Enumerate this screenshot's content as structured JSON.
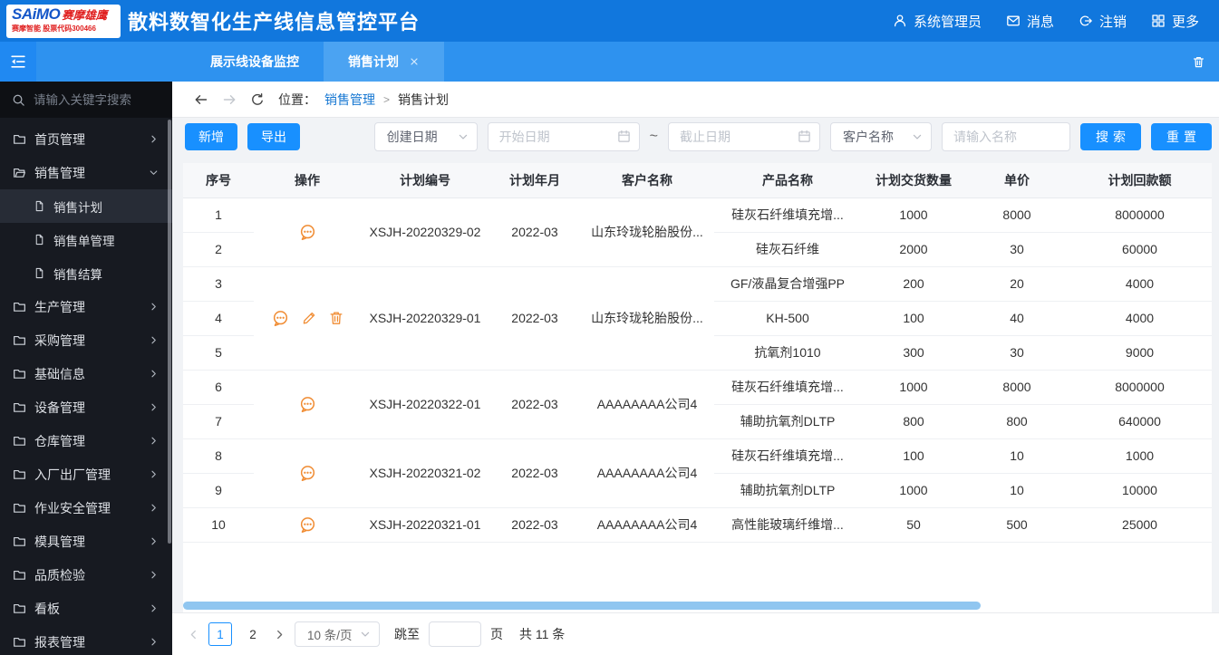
{
  "header": {
    "logo": {
      "brand": "SAiMO",
      "brand_suffix": "赛摩雄鹰",
      "subtitle": "赛摩智能 股票代码300466"
    },
    "title": "散料数智化生产线信息管控平台",
    "user_label": "系统管理员",
    "message_label": "消息",
    "logout_label": "注销",
    "more_label": "更多"
  },
  "tabbar": {
    "tabs": [
      {
        "label": "展示线设备监控",
        "active": false
      },
      {
        "label": "销售计划",
        "active": true
      }
    ]
  },
  "sidebar": {
    "search_placeholder": "请输入关键字搜索",
    "items": [
      {
        "label": "首页管理",
        "expanded": false
      },
      {
        "label": "销售管理",
        "expanded": true,
        "children": [
          {
            "label": "销售计划",
            "active": true
          },
          {
            "label": "销售单管理",
            "active": false
          },
          {
            "label": "销售结算",
            "active": false
          }
        ]
      },
      {
        "label": "生产管理",
        "expanded": false
      },
      {
        "label": "采购管理",
        "expanded": false
      },
      {
        "label": "基础信息",
        "expanded": false
      },
      {
        "label": "设备管理",
        "expanded": false
      },
      {
        "label": "仓库管理",
        "expanded": false
      },
      {
        "label": "入厂出厂管理",
        "expanded": false
      },
      {
        "label": "作业安全管理",
        "expanded": false
      },
      {
        "label": "模具管理",
        "expanded": false
      },
      {
        "label": "品质检验",
        "expanded": false
      },
      {
        "label": "看板",
        "expanded": false
      },
      {
        "label": "报表管理",
        "expanded": false
      }
    ]
  },
  "breadcrumb": {
    "prefix": "位置：",
    "parent": "销售管理",
    "separator": ">",
    "current": "销售计划"
  },
  "toolbar": {
    "add_label": "新增",
    "export_label": "导出",
    "date_type_select": "创建日期",
    "start_date_placeholder": "开始日期",
    "range_separator": "~",
    "end_date_placeholder": "截止日期",
    "customer_select": "客户名称",
    "name_input_placeholder": "请输入名称",
    "search_label": "搜索",
    "reset_label": "重置"
  },
  "table": {
    "columns": [
      "序号",
      "操作",
      "计划编号",
      "计划年月",
      "客户名称",
      "产品名称",
      "计划交货数量",
      "单价",
      "计划回款额"
    ],
    "groups": [
      {
        "plan_no": "XSJH-20220329-02",
        "plan_month": "2022-03",
        "customer": "山东玲珑轮胎股份...",
        "ops": [
          "comment"
        ],
        "rows": [
          {
            "no": "1",
            "product": "硅灰石纤维填充增...",
            "qty": "1000",
            "price": "8000",
            "amount": "8000000"
          },
          {
            "no": "2",
            "product": "硅灰石纤维",
            "qty": "2000",
            "price": "30",
            "amount": "60000"
          }
        ]
      },
      {
        "plan_no": "XSJH-20220329-01",
        "plan_month": "2022-03",
        "customer": "山东玲珑轮胎股份...",
        "ops": [
          "comment",
          "edit",
          "delete"
        ],
        "rows": [
          {
            "no": "3",
            "product": "GF/液晶复合增强PP",
            "qty": "200",
            "price": "20",
            "amount": "4000"
          },
          {
            "no": "4",
            "product": "KH-500",
            "qty": "100",
            "price": "40",
            "amount": "4000"
          },
          {
            "no": "5",
            "product": "抗氧剂1010",
            "qty": "300",
            "price": "30",
            "amount": "9000"
          }
        ]
      },
      {
        "plan_no": "XSJH-20220322-01",
        "plan_month": "2022-03",
        "customer": "AAAAAAAA公司4",
        "ops": [
          "comment"
        ],
        "rows": [
          {
            "no": "6",
            "product": "硅灰石纤维填充增...",
            "qty": "1000",
            "price": "8000",
            "amount": "8000000"
          },
          {
            "no": "7",
            "product": "辅助抗氧剂DLTP",
            "qty": "800",
            "price": "800",
            "amount": "640000"
          }
        ]
      },
      {
        "plan_no": "XSJH-20220321-02",
        "plan_month": "2022-03",
        "customer": "AAAAAAAA公司4",
        "ops": [
          "comment"
        ],
        "rows": [
          {
            "no": "8",
            "product": "硅灰石纤维填充增...",
            "qty": "100",
            "price": "10",
            "amount": "1000"
          },
          {
            "no": "9",
            "product": "辅助抗氧剂DLTP",
            "qty": "1000",
            "price": "10",
            "amount": "10000"
          }
        ]
      },
      {
        "plan_no": "XSJH-20220321-01",
        "plan_month": "2022-03",
        "customer": "AAAAAAAA公司4",
        "ops": [
          "comment"
        ],
        "rows": [
          {
            "no": "10",
            "product": "高性能玻璃纤维增...",
            "qty": "50",
            "price": "500",
            "amount": "25000"
          }
        ]
      }
    ]
  },
  "pagination": {
    "pages": [
      "1",
      "2"
    ],
    "active_page": "1",
    "page_size": "10 条/页",
    "jump_label": "跳至",
    "page_label": "页",
    "total_label": "共 11 条"
  },
  "colors": {
    "accent": "#1890ff",
    "header_blue": "#1177dd",
    "tabbar_blue": "#2e92ef",
    "tab_active_blue": "#4ba3f2",
    "sidebar_bg": "#171a21",
    "op_icon_orange": "#f08c33",
    "scrollbar_blue": "#90c6f0"
  },
  "icons": {
    "user-icon": "person-outline",
    "message-icon": "envelope",
    "logout-icon": "circle-with-right-arrow",
    "more-icon": "grid-2x2",
    "menu-fold-icon": "three-lines-left-arrow",
    "search-icon": "magnifier",
    "folder-icon": "folder-outline",
    "folder-open-icon": "open-folder-outline",
    "file-icon": "document-outline",
    "chevron-right-icon": "angle-right",
    "chevron-down-icon": "angle-down",
    "back-icon": "arrow-left",
    "forward-icon": "arrow-right",
    "refresh-icon": "circular-arrow",
    "calendar-icon": "calendar-outline",
    "comment-icon": "speech-bubble-with-dots",
    "edit-icon": "pencil",
    "delete-icon": "trash-can",
    "close-icon": "x-mark",
    "clear-tabs-icon": "trash-can"
  }
}
